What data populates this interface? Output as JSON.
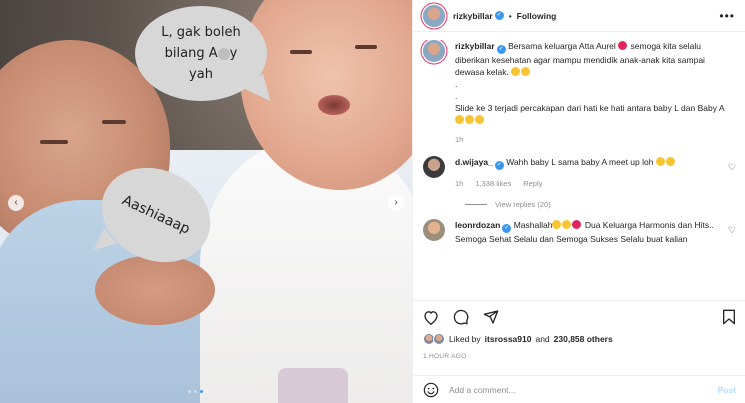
{
  "header": {
    "username": "rizkybillar",
    "follow_label": "Following",
    "more_label": "•••"
  },
  "media": {
    "bubble1_lines": [
      "L, gak boleh",
      "bilang A",
      "y",
      "yah"
    ],
    "bubble2_text": "Aashiaaap",
    "slide_count": 4,
    "active_slide": 2
  },
  "caption": {
    "username": "rizkybillar",
    "text1": "Bersama keluarga Atta Aurel",
    "text2": "semoga kita selalu diberikan kesehatan agar mampu mendidik anak-anak kita sampai dewasa kelak.",
    "dot1": ".",
    "dot2": ".",
    "text3": "Slide ke 3 terjadi percakapan dari hati ke hati antara baby L dan Baby A",
    "time": "1h"
  },
  "comments": [
    {
      "username": "d.wijaya_",
      "text": "Wahh baby L sama baby A meet up loh",
      "time": "1h",
      "likes": "1,338 likes",
      "reply": "Reply",
      "view_replies": "View replies (20)"
    },
    {
      "username": "leonrdozan",
      "text1": "Mashallah",
      "text2": "Dua Keluarga Harmonis dan Hits.. Semoga Sehat Selalu dan Semoga Sukses Selalu buat kalian"
    }
  ],
  "likes": {
    "prefix": "Liked by",
    "user": "itsrossa910",
    "and": "and",
    "count": "230,858 others"
  },
  "timestamp": "1 HOUR AGO",
  "add_comment": {
    "placeholder": "Add a comment...",
    "post_label": "Post"
  },
  "colors": {
    "accent": "#3897f0",
    "muted": "#8e8e8e",
    "bubble": "#d7d7d7",
    "post_disabled": "#b2dffc"
  },
  "icons": [
    "more-icon",
    "verified-icon",
    "heart-icon",
    "comment-icon",
    "share-icon",
    "bookmark-icon",
    "emoji-icon",
    "chevron-left-icon",
    "chevron-right-icon"
  ]
}
